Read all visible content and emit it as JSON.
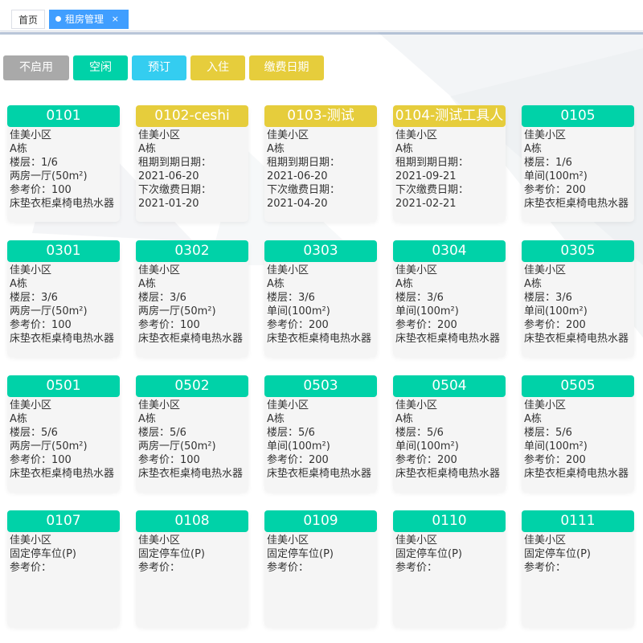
{
  "tabs": {
    "home_label": "首页",
    "active_label": "租房管理",
    "close_glyph": "×"
  },
  "colors": {
    "disabled": "#a9a9a9",
    "vacant": "#00d2a8",
    "reserved": "#34cdf0",
    "occupied": "#e6cd3c",
    "payment_date": "#e6cd3c",
    "tab_active": "#409eff"
  },
  "filters": [
    {
      "label": "不启用",
      "status": "disabled"
    },
    {
      "label": "空闲",
      "status": "vacant"
    },
    {
      "label": "预订",
      "status": "reserved"
    },
    {
      "label": "入住",
      "status": "occupied"
    },
    {
      "label": "缴费日期",
      "status": "payment_date"
    }
  ],
  "rooms": [
    {
      "title": "0101",
      "status": "vacant",
      "lines": [
        "佳美小区",
        "A栋",
        "楼层：1/6",
        "两房一厅(50m²)",
        "参考价：100",
        "床垫衣柜桌椅电热水器"
      ]
    },
    {
      "title": "0102-ceshi",
      "status": "occupied",
      "lines": [
        "佳美小区",
        "A栋",
        "租期到期日期：",
        "2021-06-20",
        "下次缴费日期：",
        "2021-01-20"
      ]
    },
    {
      "title": "0103-测试",
      "status": "occupied",
      "lines": [
        "佳美小区",
        "A栋",
        "租期到期日期：",
        "2021-06-20",
        "下次缴费日期：",
        "2021-04-20"
      ]
    },
    {
      "title": "0104-测试工具人",
      "status": "occupied",
      "lines": [
        "佳美小区",
        "A栋",
        "租期到期日期：",
        "2021-09-21",
        "下次缴费日期：",
        "2021-02-21"
      ]
    },
    {
      "title": "0105",
      "status": "vacant",
      "lines": [
        "佳美小区",
        "A栋",
        "楼层：1/6",
        "单间(100m²)",
        "参考价：200",
        "床垫衣柜桌椅电热水器"
      ]
    },
    {
      "title": "0301",
      "status": "vacant",
      "lines": [
        "佳美小区",
        "A栋",
        "楼层：3/6",
        "两房一厅(50m²)",
        "参考价：100",
        "床垫衣柜桌椅电热水器"
      ]
    },
    {
      "title": "0302",
      "status": "vacant",
      "lines": [
        "佳美小区",
        "A栋",
        "楼层：3/6",
        "两房一厅(50m²)",
        "参考价：100",
        "床垫衣柜桌椅电热水器"
      ]
    },
    {
      "title": "0303",
      "status": "vacant",
      "lines": [
        "佳美小区",
        "A栋",
        "楼层：3/6",
        "单间(100m²)",
        "参考价：200",
        "床垫衣柜桌椅电热水器"
      ]
    },
    {
      "title": "0304",
      "status": "vacant",
      "lines": [
        "佳美小区",
        "A栋",
        "楼层：3/6",
        "单间(100m²)",
        "参考价：200",
        "床垫衣柜桌椅电热水器"
      ]
    },
    {
      "title": "0305",
      "status": "vacant",
      "lines": [
        "佳美小区",
        "A栋",
        "楼层：3/6",
        "单间(100m²)",
        "参考价：200",
        "床垫衣柜桌椅电热水器"
      ]
    },
    {
      "title": "0501",
      "status": "vacant",
      "lines": [
        "佳美小区",
        "A栋",
        "楼层：5/6",
        "两房一厅(50m²)",
        "参考价：100",
        "床垫衣柜桌椅电热水器"
      ]
    },
    {
      "title": "0502",
      "status": "vacant",
      "lines": [
        "佳美小区",
        "A栋",
        "楼层：5/6",
        "两房一厅(50m²)",
        "参考价：100",
        "床垫衣柜桌椅电热水器"
      ]
    },
    {
      "title": "0503",
      "status": "vacant",
      "lines": [
        "佳美小区",
        "A栋",
        "楼层：5/6",
        "单间(100m²)",
        "参考价：200",
        "床垫衣柜桌椅电热水器"
      ]
    },
    {
      "title": "0504",
      "status": "vacant",
      "lines": [
        "佳美小区",
        "A栋",
        "楼层：5/6",
        "单间(100m²)",
        "参考价：200",
        "床垫衣柜桌椅电热水器"
      ]
    },
    {
      "title": "0505",
      "status": "vacant",
      "lines": [
        "佳美小区",
        "A栋",
        "楼层：5/6",
        "单间(100m²)",
        "参考价：200",
        "床垫衣柜桌椅电热水器"
      ]
    },
    {
      "title": "0107",
      "status": "vacant",
      "lines": [
        "佳美小区",
        "固定停车位(P)",
        "参考价："
      ]
    },
    {
      "title": "0108",
      "status": "vacant",
      "lines": [
        "佳美小区",
        "固定停车位(P)",
        "参考价："
      ]
    },
    {
      "title": "0109",
      "status": "vacant",
      "lines": [
        "佳美小区",
        "固定停车位(P)",
        "参考价："
      ]
    },
    {
      "title": "0110",
      "status": "vacant",
      "lines": [
        "佳美小区",
        "固定停车位(P)",
        "参考价："
      ]
    },
    {
      "title": "0111",
      "status": "vacant",
      "lines": [
        "佳美小区",
        "固定停车位(P)",
        "参考价："
      ]
    }
  ]
}
